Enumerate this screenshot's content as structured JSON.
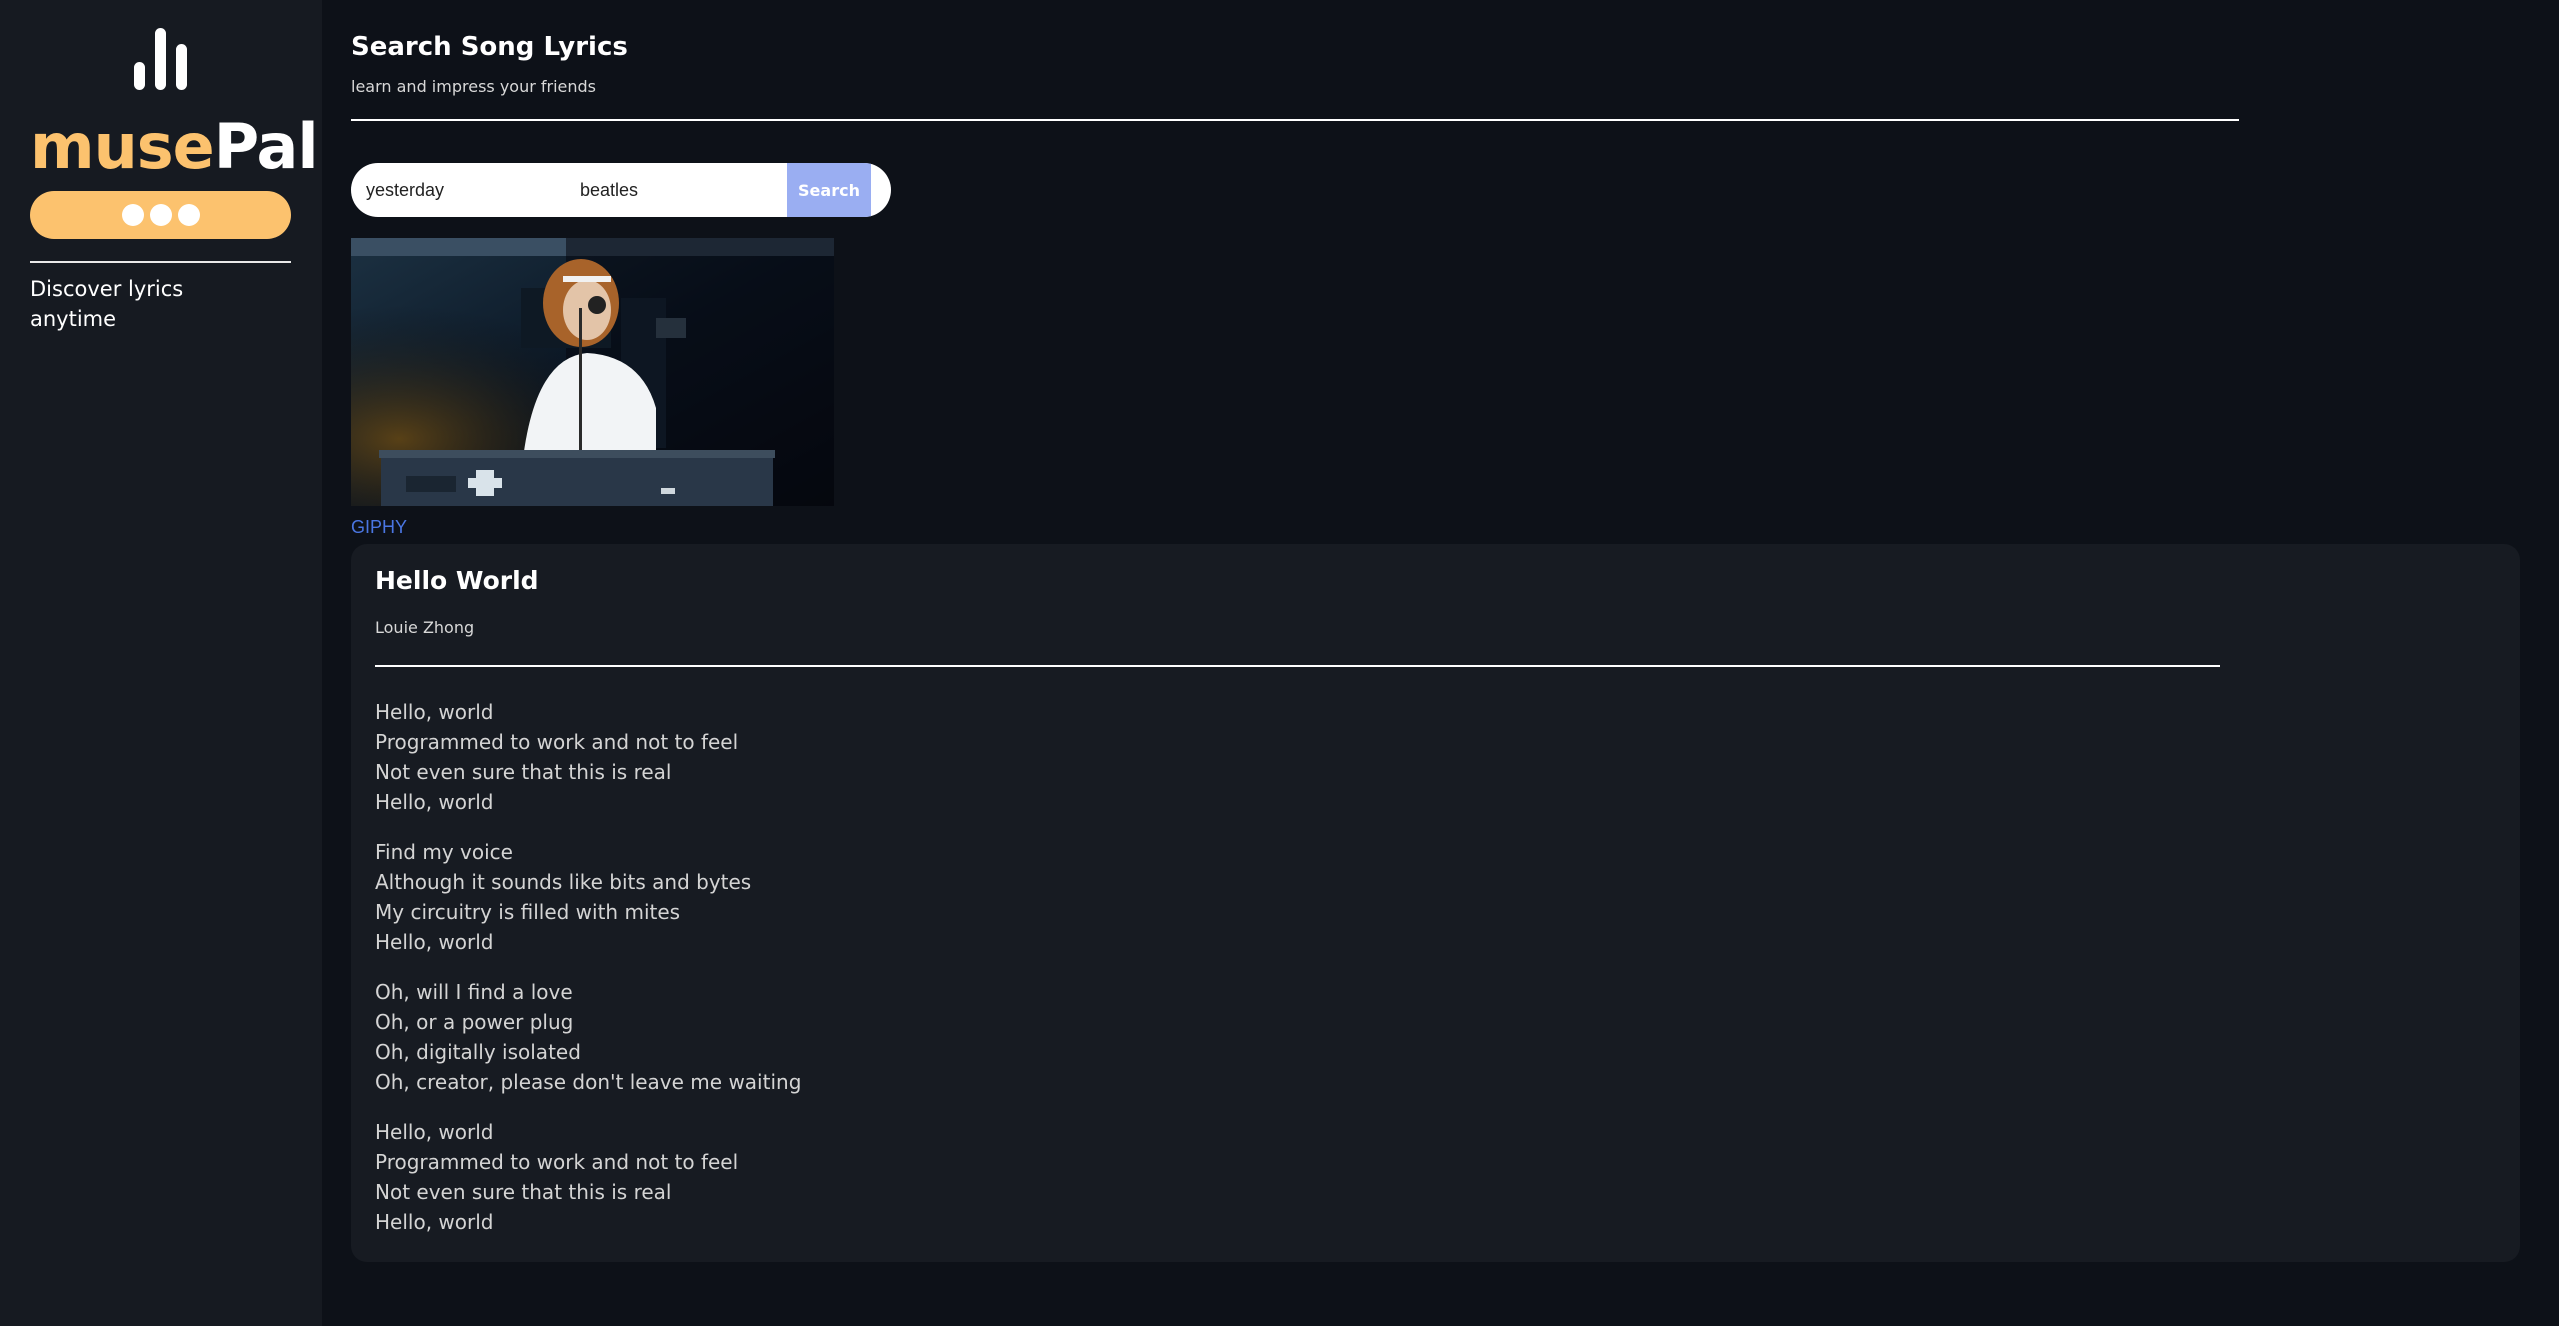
{
  "sidebar": {
    "logo_icon": "equalizer-bars-icon",
    "brand_part1": "muse",
    "brand_part2": "Pal",
    "tagline": "Discover lyrics anytime",
    "menu_icon": "three-dots-icon"
  },
  "header": {
    "title": "Search Song Lyrics",
    "subtitle": "learn and impress your friends"
  },
  "search": {
    "song_value": "yesterday",
    "artist_value": "beatles",
    "button_label": "Search"
  },
  "gif": {
    "source_label": "GIPHY"
  },
  "song": {
    "title": "Hello World",
    "artist": "Louie Zhong",
    "stanzas": [
      [
        "Hello, world",
        "Programmed to work and not to feel",
        "Not even sure that this is real",
        "Hello, world"
      ],
      [
        "Find my voice",
        "Although it sounds like bits and bytes",
        "My circuitry is filled with mites",
        "Hello, world"
      ],
      [
        "Oh, will I find a love",
        "Oh, or a power plug",
        "Oh, digitally isolated",
        "Oh, creator, please don't leave me waiting"
      ],
      [
        "Hello, world",
        "Programmed to work and not to feel",
        "Not even sure that this is real",
        "Hello, world"
      ]
    ]
  },
  "colors": {
    "accent": "#fcc26e",
    "search_button": "#9aaef2",
    "link": "#4a76e2",
    "background": "#0d1118",
    "sidebar": "#161a21",
    "card": "#171b22"
  }
}
